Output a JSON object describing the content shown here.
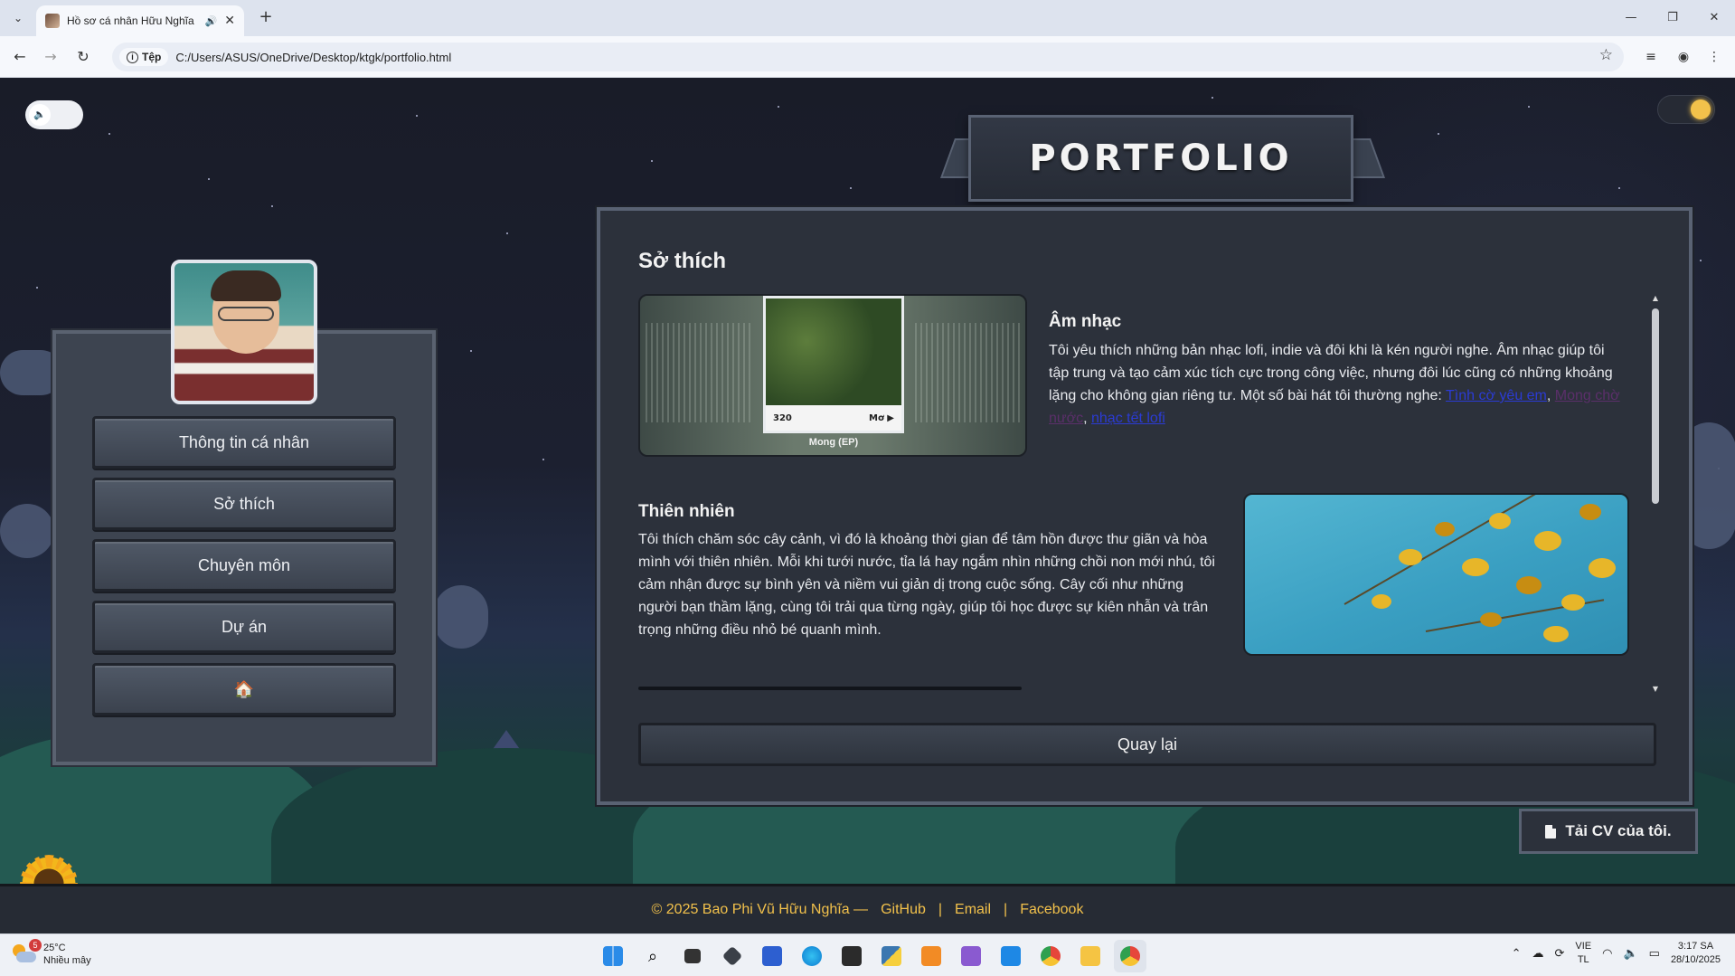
{
  "browser": {
    "tab_title": "Hồ sơ cá nhân Hữu Nghĩa",
    "site_chip": "Tệp",
    "url": "C:/Users/ASUS/OneDrive/Desktop/ktgk/portfolio.html"
  },
  "page": {
    "banner_title": "PORTFOLIO",
    "menu": [
      "Thông tin cá nhân",
      "Sở thích",
      "Chuyên môn",
      "Dự án",
      "🏠"
    ],
    "section_title": "Sở thích",
    "music": {
      "heading": "Âm nhạc",
      "text": "Tôi yêu thích những bản nhạc lofi, indie và đôi khi là kén người nghe. Âm nhạc giúp tôi tập trung và tạo cảm xúc tích cực trong công việc, nhưng đôi lúc cũng có những khoảng lặng cho không gian riêng tư. Một số bài hát tôi thường nghe:",
      "links": [
        "Tình cờ yêu em",
        "Mong chờ nước",
        "nhạc tết lofi"
      ],
      "link_sep": ", ",
      "album_caption": "Mong (EP)",
      "album_number": "320",
      "album_label": "Mơ ▶"
    },
    "nature": {
      "heading": "Thiên nhiên",
      "text": "Tôi thích chăm sóc cây cảnh, vì đó là khoảng thời gian để tâm hồn được thư giãn và hòa mình với thiên nhiên. Mỗi khi tưới nước, tỉa lá hay ngắm nhìn những chồi non mới nhú, tôi cảm nhận được sự bình yên và niềm vui giản dị trong cuộc sống. Cây cối như những người bạn thầm lặng, cùng tôi trải qua từng ngày, giúp tôi học được sự kiên nhẫn và trân trọng những điều nhỏ bé quanh mình."
    },
    "back_button": "Quay lại",
    "cv_button": "Tải CV của tôi.",
    "footer": {
      "copyright": "© 2025 Bao Phi Vũ Hữu Nghĩa —",
      "links": [
        "GitHub",
        "Email",
        "Facebook"
      ],
      "sep": "|"
    }
  },
  "taskbar": {
    "weather_temp": "25°C",
    "weather_desc": "Nhiều mây",
    "weather_badge": "5",
    "lang_1": "VIE",
    "lang_2": "TL",
    "time": "3:17 SA",
    "date": "28/10/2025"
  },
  "colors": {
    "accent_footer": "#f2c14b",
    "panel_bg": "#2c313b",
    "link_unvisited": "#2b3bd4",
    "link_visited": "#5b2f6a"
  }
}
